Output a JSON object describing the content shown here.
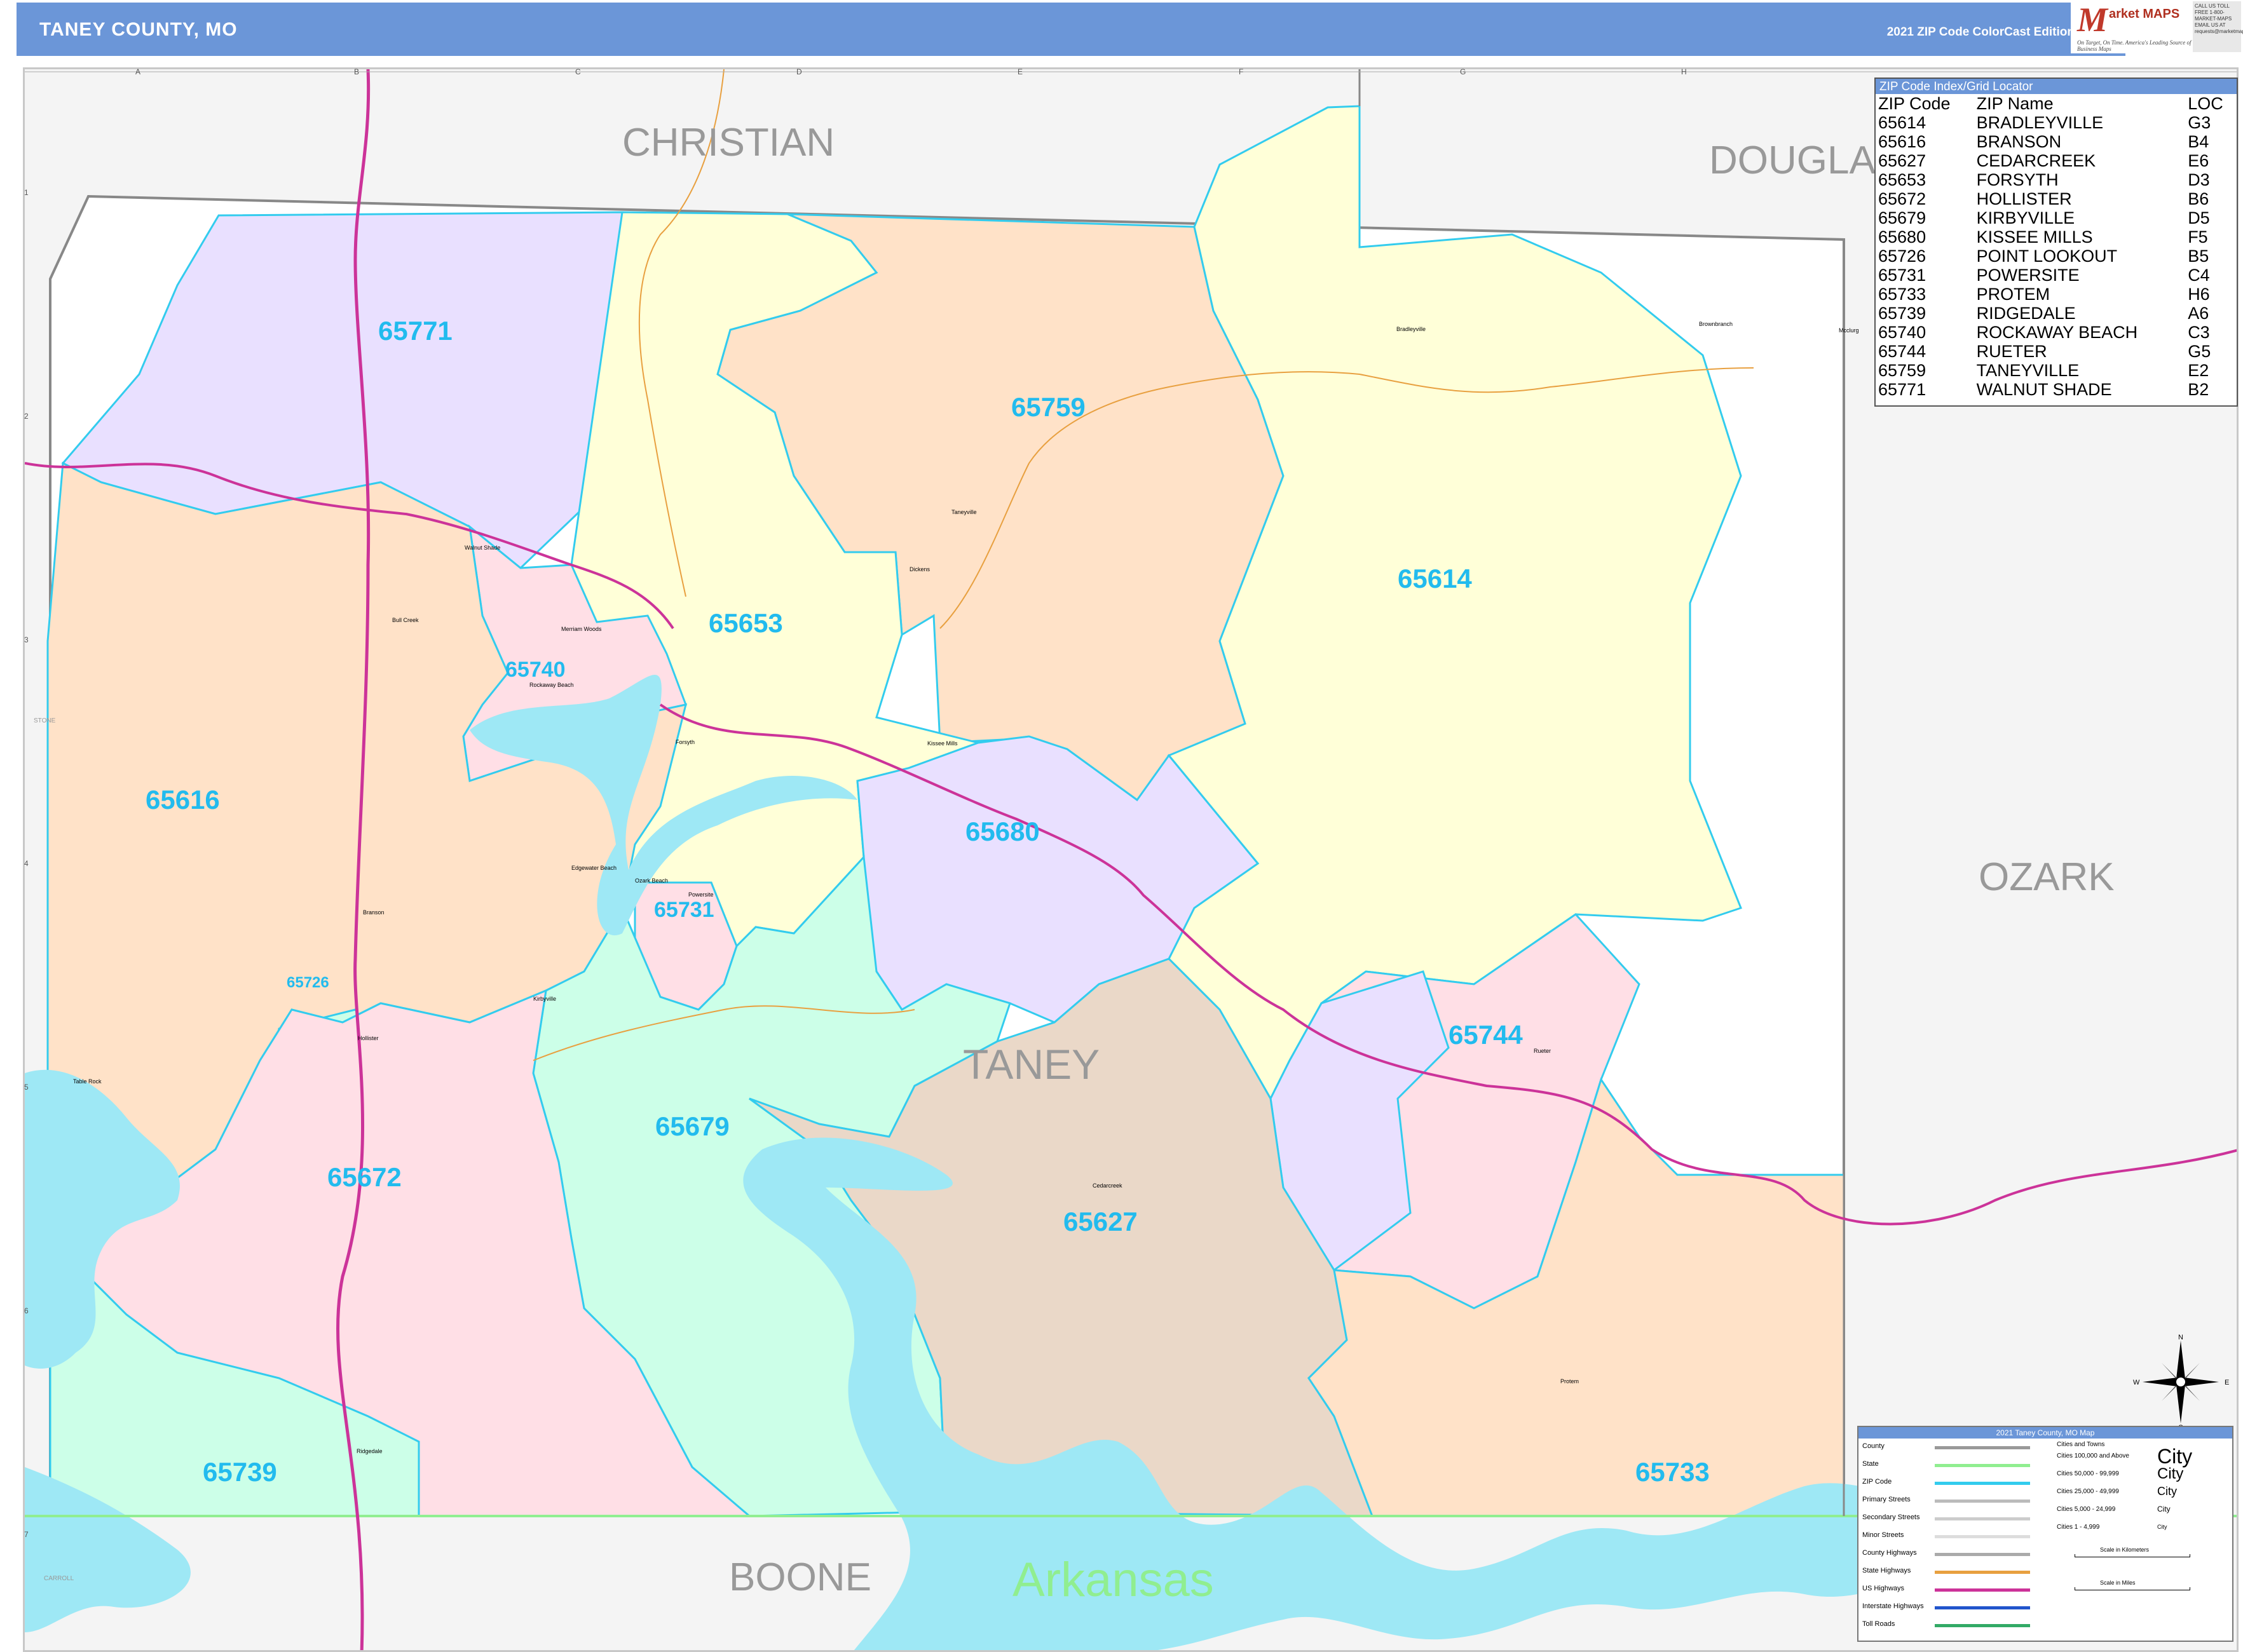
{
  "header": {
    "title": "TANEY COUNTY, MO",
    "edition": "2021 ZIP Code ColorCast Edition",
    "logo_mark": "M",
    "logo_text": "arket MAPS",
    "logo_tagline": "On Target, On Time. America's Leading Source of Business Maps",
    "contact": "CALL US TOLL FREE 1-800-MARKET-MAPS EMAIL US AT requests@marketmaps.com"
  },
  "grid": {
    "columns": [
      "A",
      "B",
      "C",
      "D",
      "E",
      "F",
      "G",
      "H"
    ],
    "rows": [
      "1",
      "2",
      "3",
      "4",
      "5",
      "6",
      "7"
    ]
  },
  "neighbors": {
    "christian": "CHRISTIAN",
    "douglas": "DOUGLA",
    "ozark": "OZARK",
    "boone": "BOONE",
    "arkansas": "Arkansas",
    "taney": "TANEY",
    "stone": "STONE",
    "carroll": "CARROLL"
  },
  "zip_labels": [
    {
      "zip": "65771",
      "color": "#e9e0ff"
    },
    {
      "zip": "65759",
      "color": "#ffe2c8"
    },
    {
      "zip": "65653",
      "color": "#ffffd8"
    },
    {
      "zip": "65740",
      "color": "#ffdfe6"
    },
    {
      "zip": "65614",
      "color": "#ffffd8"
    },
    {
      "zip": "65616",
      "color": "#ffe2c8"
    },
    {
      "zip": "65680",
      "color": "#e9e0ff"
    },
    {
      "zip": "65731",
      "color": "#ffdfe6"
    },
    {
      "zip": "65726",
      "color": "#ccffe8"
    },
    {
      "zip": "65744",
      "color": "#ffdfe6"
    },
    {
      "zip": "65679",
      "color": "#ccffe8"
    },
    {
      "zip": "65672",
      "color": "#ffdfe6"
    },
    {
      "zip": "65627",
      "color": "#ead8c8"
    },
    {
      "zip": "65739",
      "color": "#ccffe8"
    },
    {
      "zip": "65733",
      "color": "#ffe2c8"
    }
  ],
  "towns": {
    "bradleyville": "Bradleyville",
    "brownbranch": "Brownbranch",
    "mcclurg": "Mcclurg",
    "taneyville": "Taneyville",
    "walnut_shade": "Walnut Shade",
    "bull_creek": "Bull Creek",
    "merriam_woods": "Merriam Woods",
    "rockaway_beach": "Rockaway Beach",
    "forsyth": "Forsyth",
    "kissee_mills": "Kissee Mills",
    "dickens": "Dickens",
    "edgewater_beach": "Edgewater Beach",
    "ozark_beach": "Ozark Beach",
    "powersite": "Powersite",
    "branson": "Branson",
    "hollister": "Hollister",
    "kirbyville": "Kirbyville",
    "table_rock": "Table Rock",
    "cedarcreek": "Cedarcreek",
    "rueter": "Rueter",
    "protem": "Protem",
    "ridgedale": "Ridgedale"
  },
  "zip_index": {
    "title": "ZIP Code Index/Grid Locator",
    "headers": [
      "ZIP Code",
      "ZIP Name",
      "LOC"
    ],
    "rows": [
      [
        "65614",
        "BRADLEYVILLE",
        "G3"
      ],
      [
        "65616",
        "BRANSON",
        "B4"
      ],
      [
        "65627",
        "CEDARCREEK",
        "E6"
      ],
      [
        "65653",
        "FORSYTH",
        "D3"
      ],
      [
        "65672",
        "HOLLISTER",
        "B6"
      ],
      [
        "65679",
        "KIRBYVILLE",
        "D5"
      ],
      [
        "65680",
        "KISSEE MILLS",
        "F5"
      ],
      [
        "65726",
        "POINT LOOKOUT",
        "B5"
      ],
      [
        "65731",
        "POWERSITE",
        "C4"
      ],
      [
        "65733",
        "PROTEM",
        "H6"
      ],
      [
        "65739",
        "RIDGEDALE",
        "A6"
      ],
      [
        "65740",
        "ROCKAWAY BEACH",
        "C3"
      ],
      [
        "65744",
        "RUETER",
        "G5"
      ],
      [
        "65759",
        "TANEYVILLE",
        "E2"
      ],
      [
        "65771",
        "WALNUT SHADE",
        "B2"
      ]
    ]
  },
  "legend": {
    "title": "2021 Taney County, MO Map",
    "items": [
      {
        "label": "County",
        "color": "#999999"
      },
      {
        "label": "State",
        "color": "#90ee90"
      },
      {
        "label": "ZIP Code",
        "color": "#33ccee"
      },
      {
        "label": "Primary Streets",
        "color": "#bbbbbb"
      },
      {
        "label": "Secondary Streets",
        "color": "#cccccc"
      },
      {
        "label": "Minor Streets",
        "color": "#dddddd"
      },
      {
        "label": "County Highways",
        "color": "#aaaaaa"
      },
      {
        "label": "State Highways",
        "color": "#e8a040"
      },
      {
        "label": "US Highways",
        "color": "#cc3399"
      },
      {
        "label": "Interstate Highways",
        "color": "#2255cc"
      },
      {
        "label": "Toll Roads",
        "color": "#33aa66"
      }
    ],
    "cities_title": "Cities and Towns",
    "city_sizes": [
      "Cities 100,000 and Above",
      "Cities 50,000 - 99,999",
      "Cities 25,000 - 49,999",
      "Cities 5,000 - 24,999",
      "Cities 1 - 4,999"
    ],
    "city_samples": [
      "City",
      "City",
      "City",
      "City",
      "City"
    ],
    "scale_km": "Scale in Kilometers",
    "scale_mi": "Scale in Miles"
  },
  "compass": {
    "n": "N",
    "s": "S",
    "e": "E",
    "w": "W"
  },
  "colors": {
    "header": "#6b96d8",
    "water": "#9ee8f5",
    "zip_border": "#33ccee",
    "us_highway": "#cc3399",
    "zip_label": "#22bbee"
  }
}
